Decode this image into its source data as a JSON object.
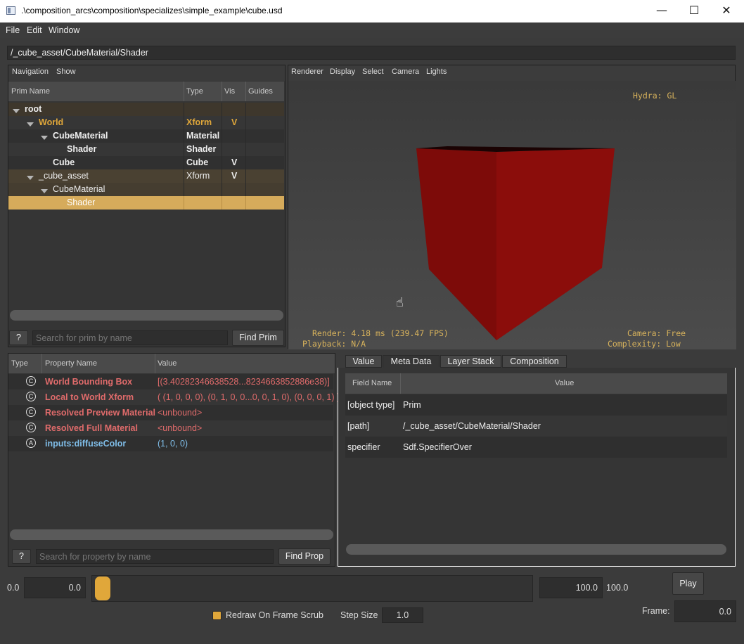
{
  "window": {
    "title": ".\\composition_arcs\\composition\\specializes\\simple_example\\cube.usd",
    "minimize": "—",
    "maximize": "☐",
    "close": "✕"
  },
  "menu": {
    "file": "File",
    "edit": "Edit",
    "window": "Window"
  },
  "path": "/_cube_asset/CubeMaterial/Shader",
  "navigation": {
    "menu": [
      "Navigation",
      "Show"
    ],
    "columns": [
      "Prim Name",
      "Type",
      "Vis",
      "Guides"
    ],
    "rows": [
      {
        "name": "root",
        "type": "",
        "vis": ""
      },
      {
        "name": "World",
        "type": "Xform",
        "vis": "V"
      },
      {
        "name": "CubeMaterial",
        "type": "Material",
        "vis": ""
      },
      {
        "name": "Shader",
        "type": "Shader",
        "vis": ""
      },
      {
        "name": "Cube",
        "type": "Cube",
        "vis": "V"
      },
      {
        "name": "_cube_asset",
        "type": "Xform",
        "vis": "V"
      },
      {
        "name": "CubeMaterial",
        "type": "",
        "vis": ""
      },
      {
        "name": "Shader",
        "type": "",
        "vis": ""
      }
    ],
    "help": "?",
    "search_placeholder": "Search for prim by name",
    "find_button": "Find Prim"
  },
  "viewport": {
    "menu": [
      "Renderer",
      "Display",
      "Select",
      "Camera",
      "Lights"
    ],
    "hydra": "Hydra: GL",
    "render": "Render: 4.18 ms (239.47 FPS)",
    "playback": "Playback: N/A",
    "camera": "Camera: Free",
    "complexity": "Complexity: Low",
    "cube_color": "#8b0d0b"
  },
  "properties": {
    "columns": [
      "Type",
      "Property Name",
      "Value"
    ],
    "rows": [
      {
        "icon": "C",
        "name": "World Bounding Box",
        "value": "[(3.40282346638528...8234663852886e38)]"
      },
      {
        "icon": "C",
        "name": "Local to World Xform",
        "value": "( (1, 0, 0, 0), (0, 1, 0, 0...0, 0, 1, 0), (0, 0, 0, 1) )"
      },
      {
        "icon": "C",
        "name": "Resolved Preview Material",
        "value": "<unbound>"
      },
      {
        "icon": "C",
        "name": "Resolved Full Material",
        "value": "<unbound>"
      },
      {
        "icon": "A",
        "name": "inputs:diffuseColor",
        "value": "(1, 0, 0)"
      }
    ],
    "help": "?",
    "search_placeholder": "Search for property by name",
    "find_button": "Find Prop"
  },
  "metadata": {
    "tabs": [
      "Value",
      "Meta Data",
      "Layer Stack",
      "Composition"
    ],
    "columns": [
      "Field Name",
      "Value"
    ],
    "rows": [
      {
        "field": "[object type]",
        "value": "Prim"
      },
      {
        "field": "[path]",
        "value": "/_cube_asset/CubeMaterial/Shader"
      },
      {
        "field": "specifier",
        "value": "Sdf.SpecifierOver"
      }
    ]
  },
  "timeline": {
    "range_start_label": "0.0",
    "start_field": "0.0",
    "end_field": "100.0",
    "range_end_label": "100.0",
    "play": "Play",
    "frame_label": "Frame:",
    "frame_value": "0.0",
    "redraw_label": "Redraw On Frame Scrub",
    "redraw_checked": true,
    "step_label": "Step Size",
    "step_value": "1.0",
    "slider_position": 0
  },
  "colors": {
    "accent": "#e0a73a",
    "selection": "#d6ab5b",
    "computed": "#e06b6b",
    "attribute": "#7fbde8"
  }
}
